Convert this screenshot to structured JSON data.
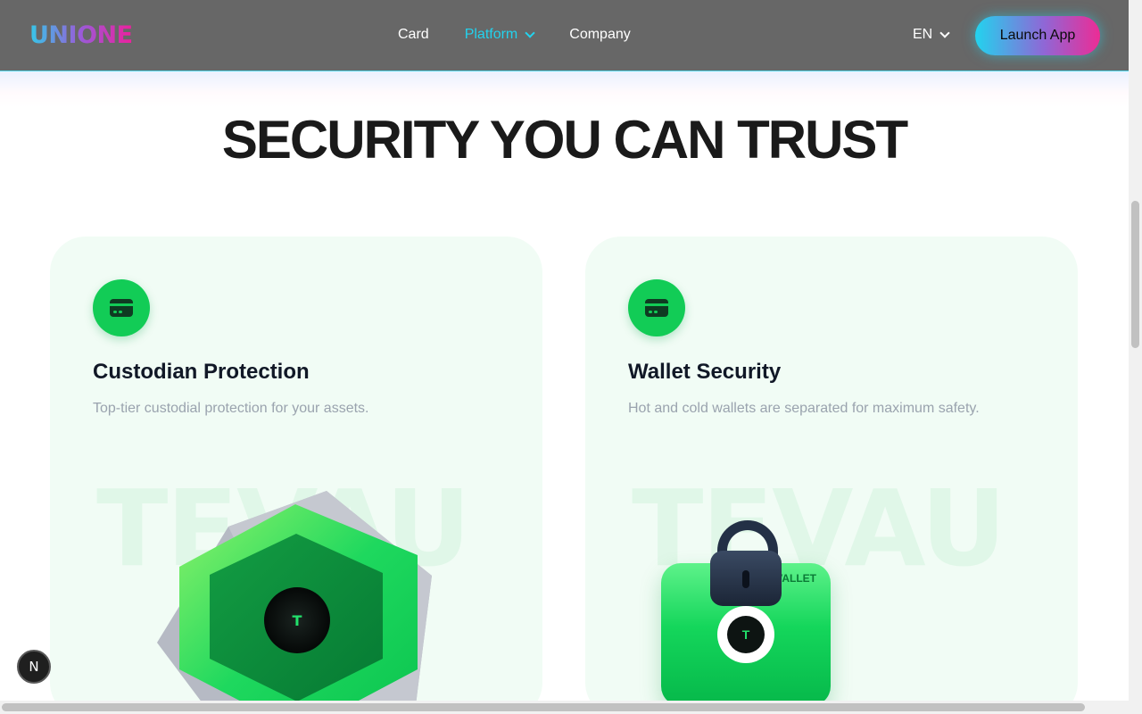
{
  "header": {
    "logo": "UNIONE",
    "nav": [
      {
        "label": "Card"
      },
      {
        "label": "Platform"
      },
      {
        "label": "Company"
      }
    ],
    "language": "EN",
    "launch_label": "Launch App"
  },
  "section": {
    "title": "SECURITY YOU CAN TRUST"
  },
  "cards": [
    {
      "title": "Custodian Protection",
      "description": "Top-tier custodial protection for your assets.",
      "watermark": "TEVAU",
      "icon": "card-icon",
      "coin_letter": "T"
    },
    {
      "title": "Wallet Security",
      "description": "Hot and cold wallets are separated for maximum safety.",
      "watermark": "TEVAU",
      "icon": "card-icon",
      "wallet_label": "VALLET",
      "coin_letter": "T"
    }
  ],
  "badge": "N",
  "colors": {
    "header_bg": "#676767",
    "accent": "#22d3ee",
    "brand_pink": "#ec2c95",
    "green": "#12cc56",
    "card_bg": "#f1fcf5",
    "title": "#1a1a1a"
  }
}
